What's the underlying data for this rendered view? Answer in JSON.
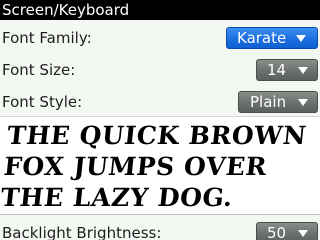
{
  "title_bar": {
    "title": "Screen/Keyboard"
  },
  "settings": {
    "font_family": {
      "label": "Font Family:",
      "value": "Karate"
    },
    "font_size": {
      "label": "Font Size:",
      "value": "14"
    },
    "font_style": {
      "label": "Font Style:",
      "value": "Plain"
    }
  },
  "preview": {
    "text": "The quick brown fox jumps over the lazy dog."
  },
  "backlight": {
    "label": "Backlight Brightness:",
    "value": "50"
  },
  "colors": {
    "title_bar_bg": "#000000",
    "selected_dropdown": "#1c6fe0",
    "dropdown": "#6e726e",
    "background": "#f4f8f3"
  },
  "icons": {
    "dropdown_arrow": "chevron-down-icon"
  }
}
